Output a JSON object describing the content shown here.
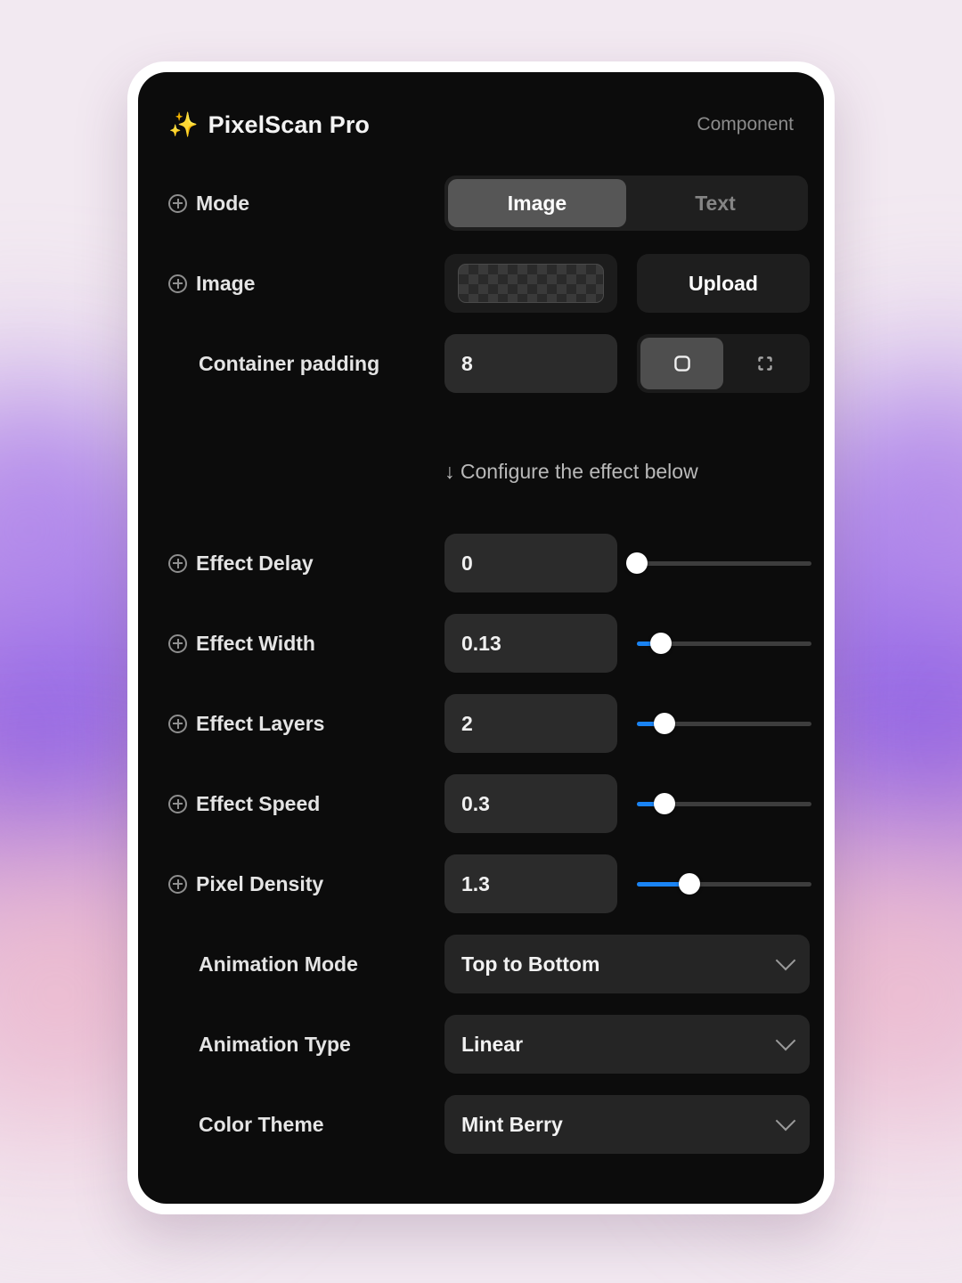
{
  "header": {
    "sparkle_icon": "sparkle-icon",
    "title": "PixelScan Pro",
    "badge": "Component"
  },
  "mode_row": {
    "label": "Mode",
    "options": [
      "Image",
      "Text"
    ],
    "selected": "Image"
  },
  "image_row": {
    "label": "Image",
    "thumbnail": "transparent-checkerboard",
    "upload_label": "Upload"
  },
  "padding_row": {
    "label": "Container padding",
    "value": "8",
    "toggle_icons": [
      "rounded-square-icon",
      "dashed-frame-icon"
    ],
    "selected_index": 0
  },
  "hint": {
    "text": "↓ Configure the effect below"
  },
  "sliders": [
    {
      "label": "Effect Delay",
      "value": "0",
      "percent": 0
    },
    {
      "label": "Effect Width",
      "value": "0.13",
      "percent": 14
    },
    {
      "label": "Effect Layers",
      "value": "2",
      "percent": 16
    },
    {
      "label": "Effect Speed",
      "value": "0.3",
      "percent": 16
    },
    {
      "label": "Pixel Density",
      "value": "1.3",
      "percent": 30
    }
  ],
  "dropdowns": [
    {
      "label": "Animation Mode",
      "value": "Top to Bottom"
    },
    {
      "label": "Animation Type",
      "value": "Linear"
    },
    {
      "label": "Color Theme",
      "value": "Mint Berry"
    }
  ],
  "colors": {
    "page_background": "#f2e9f1",
    "card_border": "#ffffff",
    "card_background": "#0c0c0c",
    "accent_blue": "#1a84f5",
    "sparkle_gold": "#f5c542",
    "input_background": "#2b2b2b",
    "muted_text": "#8c8c8c",
    "blob_purple": "#7b4ae8",
    "blob_pink": "#e7a8c0"
  }
}
